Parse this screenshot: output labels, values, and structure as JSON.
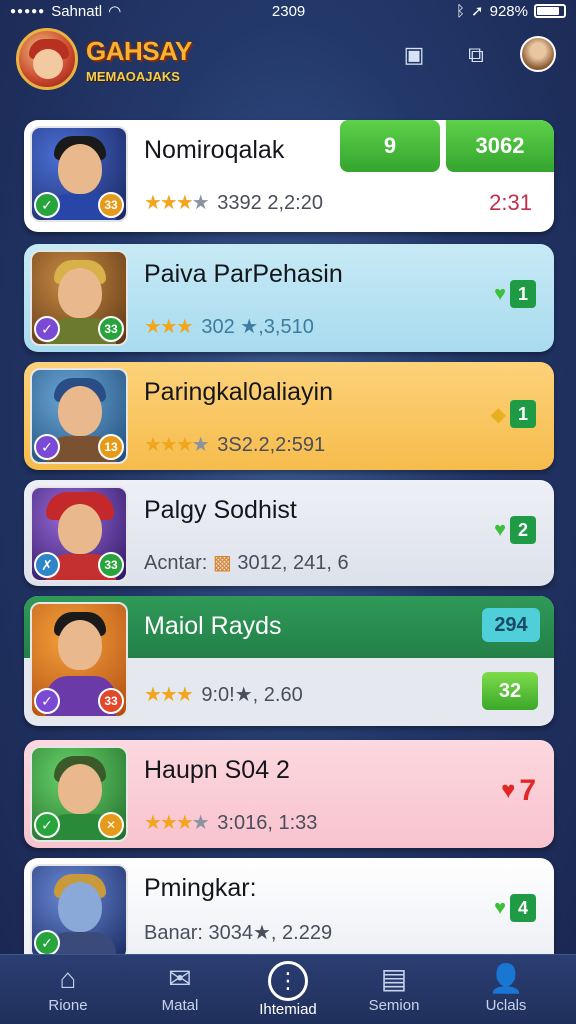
{
  "status": {
    "carrier": "Sahnatl",
    "time": "2309",
    "battery": "928%"
  },
  "header": {
    "title": "GAHSAY",
    "subtitle": "MEMAOAJAKS"
  },
  "cards": [
    {
      "title": "Nomiroqalak",
      "meta": "3392 2,2:20",
      "right_top": "9",
      "right_badge": "3062",
      "right_value": "2:31",
      "badge_l": "✓",
      "badge_r": "33"
    },
    {
      "title": "Paiva ParPehasin",
      "meta": "302 ★,3,510",
      "right_value": "1",
      "badge_l": "✓",
      "badge_r": "33"
    },
    {
      "title": "Paringkal0aliayin",
      "meta": "3S2.2,2:591",
      "right_value": "1",
      "badge_l": "✓",
      "badge_r": "13"
    },
    {
      "title": "Palgy Sodhist",
      "meta_prefix": "Acntar:",
      "meta": "3012, 241, 6",
      "right_value": "2",
      "badge_l": "✗",
      "badge_r": "33"
    },
    {
      "title": "Maiol Rayds",
      "meta": "9:0!★, 2.60",
      "right_top": "294",
      "right_value": "32",
      "badge_l": "✓",
      "badge_r": "33"
    },
    {
      "title": "Haupn S04 2",
      "meta": "3:016, 1:33",
      "right_value": "7",
      "badge_l": "✓",
      "badge_r": "✕"
    },
    {
      "title": "Pmingkar:",
      "meta_prefix": "Banar:",
      "meta": "3034★, 2.229",
      "right_value": "4",
      "badge_l": "✓",
      "badge_r": ""
    }
  ],
  "tabs": [
    {
      "label": "Rione",
      "icon": "home-icon"
    },
    {
      "label": "Matal",
      "icon": "mail-icon"
    },
    {
      "label": "Ihtemiad",
      "icon": "info-icon"
    },
    {
      "label": "Semion",
      "icon": "briefcase-icon"
    },
    {
      "label": "Uclals",
      "icon": "user-icon"
    }
  ]
}
